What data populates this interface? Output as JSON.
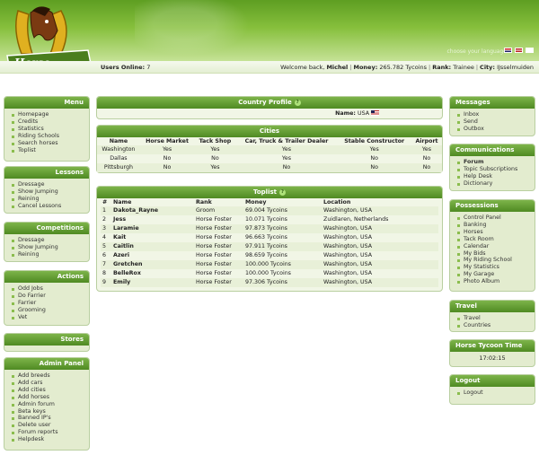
{
  "header": {
    "logo_text": "Horse Tycoon",
    "choose_language": "choose your language"
  },
  "infobar": {
    "online_label": "Users Online:",
    "online_count": "7",
    "welcome_label": "Welcome back,",
    "user": "Michel",
    "money_label": "Money:",
    "money": "265.782 Tycoins",
    "rank_label": "Rank:",
    "rank": "Trainee",
    "city_label": "City:",
    "city": "IJsselmuiden"
  },
  "left": {
    "menu": {
      "title": "Menu",
      "items": [
        "Homepage",
        "Credits",
        "Statistics",
        "Riding Schools",
        "Search horses",
        "Toplist"
      ]
    },
    "lessons": {
      "title": "Lessons",
      "items": [
        "Dressage",
        "Show Jumping",
        "Reining",
        "Cancel Lessons"
      ]
    },
    "competitions": {
      "title": "Competitions",
      "items": [
        "Dressage",
        "Show Jumping",
        "Reining"
      ]
    },
    "actions": {
      "title": "Actions",
      "items": [
        "Odd Jobs",
        "Do Farrier",
        "Farrier",
        "Grooming",
        "Vet"
      ]
    },
    "stores": {
      "title": "Stores"
    },
    "admin": {
      "title": "Admin Panel",
      "items": [
        "Add breeds",
        "Add cars",
        "Add cities",
        "Add horses",
        "Admin forum",
        "Beta keys",
        "Banned IP's",
        "Delete user",
        "Forum reports",
        "Helpdesk"
      ]
    }
  },
  "right": {
    "messages": {
      "title": "Messages",
      "items": [
        "Inbox",
        "Send",
        "Outbox"
      ]
    },
    "communications": {
      "title": "Communications",
      "items": [
        "Forum",
        "Topic Subscriptions",
        "Help Desk",
        "Dictionary"
      ]
    },
    "possessions": {
      "title": "Possessions",
      "items": [
        "Control Panel",
        "Banking",
        "Horses",
        "Tack Room",
        "Calendar",
        "My Bids",
        "My Riding School",
        "My Statistics",
        "My Garage",
        "Photo Album"
      ]
    },
    "travel": {
      "title": "Travel",
      "items": [
        "Travel",
        "Countries"
      ]
    },
    "time": {
      "title": "Horse Tycoon Time",
      "value": "17:02:15"
    },
    "logout": {
      "title": "Logout",
      "items": [
        "Logout"
      ]
    }
  },
  "country": {
    "title": "Country Profile",
    "name_label": "Name:",
    "name": "USA"
  },
  "cities": {
    "title": "Cities",
    "headers": [
      "Name",
      "Horse Market",
      "Tack Shop",
      "Car, Truck & Trailer Dealer",
      "Stable Constructor",
      "Airport"
    ],
    "rows": [
      [
        "Washington",
        "Yes",
        "Yes",
        "Yes",
        "Yes",
        "Yes"
      ],
      [
        "Dallas",
        "No",
        "No",
        "Yes",
        "No",
        "No"
      ],
      [
        "Pittsburgh",
        "No",
        "Yes",
        "No",
        "No",
        "No"
      ]
    ]
  },
  "toplist": {
    "title": "Toplist",
    "headers": [
      "#",
      "Name",
      "Rank",
      "Money",
      "Location"
    ],
    "rows": [
      [
        "1",
        "Dakota_Rayne",
        "Groom",
        "69.004 Tycoins",
        "Washington, USA"
      ],
      [
        "2",
        "Jess",
        "Horse Foster",
        "10.071 Tycoins",
        "Zuidlaren, Netherlands"
      ],
      [
        "3",
        "Laramie",
        "Horse Foster",
        "97.873 Tycoins",
        "Washington, USA"
      ],
      [
        "4",
        "Kait",
        "Horse Foster",
        "96.663 Tycoins",
        "Washington, USA"
      ],
      [
        "5",
        "Caitlin",
        "Horse Foster",
        "97.911 Tycoins",
        "Washington, USA"
      ],
      [
        "6",
        "Azeri",
        "Horse Foster",
        "98.659 Tycoins",
        "Washington, USA"
      ],
      [
        "7",
        "Gretchen",
        "Horse Foster",
        "100.000 Tycoins",
        "Washington, USA"
      ],
      [
        "8",
        "BelleRox",
        "Horse Foster",
        "100.000 Tycoins",
        "Washington, USA"
      ],
      [
        "9",
        "Emily",
        "Horse Foster",
        "97.306 Tycoins",
        "Washington, USA"
      ]
    ]
  },
  "colors": {
    "header_green": "#5e9e22",
    "box_bg": "#e3eccf",
    "header_bar": "#4f8a22"
  }
}
